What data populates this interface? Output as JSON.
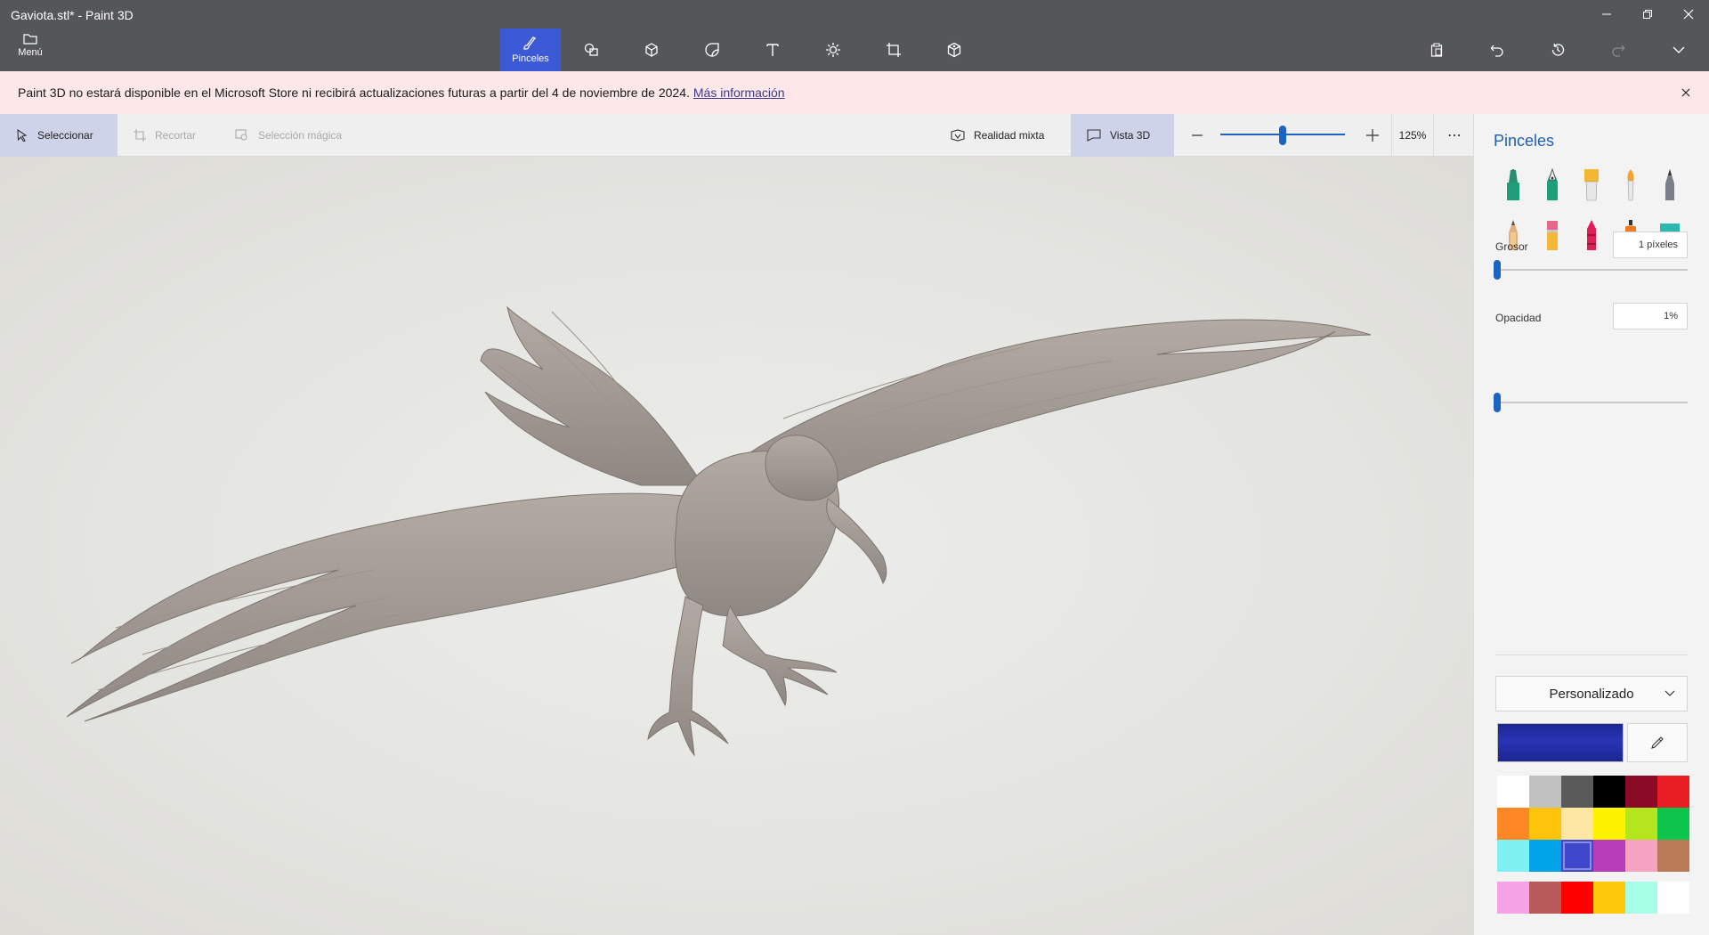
{
  "window": {
    "title": "Gaviota.stl* - Paint 3D",
    "minimize_glyph": "—",
    "restore_glyph": "❐",
    "close_glyph": "✕"
  },
  "ribbon": {
    "menu_label": "Menú",
    "tools": [
      {
        "name": "brushes",
        "label": "Pinceles",
        "icon": "brush-icon",
        "active": true
      },
      {
        "name": "2d-shapes",
        "label": "",
        "icon": "2d-shapes-icon"
      },
      {
        "name": "3d-shapes",
        "label": "",
        "icon": "3d-cube-icon"
      },
      {
        "name": "stickers",
        "label": "",
        "icon": "sticker-icon"
      },
      {
        "name": "text",
        "label": "",
        "icon": "text-icon"
      },
      {
        "name": "effects",
        "label": "",
        "icon": "sun-icon"
      },
      {
        "name": "canvas",
        "label": "",
        "icon": "crop-canvas-icon"
      },
      {
        "name": "3d-library",
        "label": "",
        "icon": "3d-library-icon"
      }
    ],
    "right_tools": [
      "paste-icon",
      "undo-icon",
      "history-icon",
      "redo-icon",
      "chevron-down-icon"
    ]
  },
  "notice": {
    "text": "Paint 3D no estará disponible en el Microsoft Store ni recibirá actualizaciones futuras a partir del 4 de noviembre de 2024.",
    "link": "Más información"
  },
  "canvas_toolbar": {
    "select": "Seleccionar",
    "crop": "Recortar",
    "magic_select": "Selección mágica",
    "mixed_reality": "Realidad mixta",
    "view_3d": "Vista 3D",
    "zoom_percent": "125%",
    "more": "⋯"
  },
  "panel": {
    "title": "Pinceles",
    "brushes": [
      {
        "name": "marker",
        "color": "#1f9e7a"
      },
      {
        "name": "calligraphy-pen",
        "color": "#1f9e7a"
      },
      {
        "name": "oil-brush",
        "color": "#f2b733"
      },
      {
        "name": "watercolor",
        "color": "#f2a52a"
      },
      {
        "name": "pixel-pen",
        "color": "#7a7f8a"
      },
      {
        "name": "pencil",
        "color": "#e0b080"
      },
      {
        "name": "eraser",
        "color": "#e8668e"
      },
      {
        "name": "crayon",
        "color": "#e21d55"
      },
      {
        "name": "spray-can",
        "color": "#f0781e"
      },
      {
        "name": "fill",
        "color": "#2bb8b0"
      }
    ],
    "thickness_label": "Grosor",
    "thickness_value": "1 píxeles",
    "opacity_label": "Opacidad",
    "opacity_value": "1%",
    "dropdown_label": "Personalizado",
    "current_color": "#1c2590",
    "palette": [
      "#ffffff",
      "#c0c0c0",
      "#5a5a5a",
      "#000000",
      "#8b0a25",
      "#e81e24",
      "#fd8725",
      "#ffc30b",
      "#fde7a2",
      "#fff200",
      "#b5e61d",
      "#0ec44b",
      "#7ff1f3",
      "#00a2e8",
      "#3f48cc",
      "#b83dba",
      "#f5a3c0",
      "#b97a57"
    ],
    "selected_index": 14,
    "recent": [
      "#f5a3e6",
      "#b85a5a",
      "#ff0000",
      "#ffc90e",
      "#a6ffe6",
      "#ffffff"
    ]
  }
}
